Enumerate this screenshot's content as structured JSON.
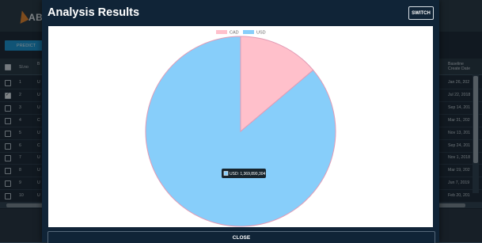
{
  "background_app": {
    "logo_text": "ABC",
    "predict_button": "PREDICT",
    "table": {
      "headers": [
        "Sl.no",
        "B",
        "Baseline\nCreate Date"
      ],
      "rows": [
        {
          "sl": "1",
          "col": "U",
          "date": "Jan 26, 202",
          "checked": false
        },
        {
          "sl": "2",
          "col": "U",
          "date": "Jul 22, 2018",
          "checked": true
        },
        {
          "sl": "3",
          "col": "U",
          "date": "Sep 14, 201",
          "checked": false
        },
        {
          "sl": "4",
          "col": "C",
          "date": "Mar 31, 202",
          "checked": false
        },
        {
          "sl": "5",
          "col": "U",
          "date": "Nov 13, 201",
          "checked": false
        },
        {
          "sl": "6",
          "col": "C",
          "date": "Sep 24, 201",
          "checked": false
        },
        {
          "sl": "7",
          "col": "U",
          "date": "Nov 1, 2018",
          "checked": false
        },
        {
          "sl": "8",
          "col": "U",
          "date": "Mar 19, 202",
          "checked": false
        },
        {
          "sl": "9",
          "col": "U",
          "date": "Jun 7, 2019",
          "checked": false
        },
        {
          "sl": "10",
          "col": "U",
          "date": "Feb 20, 201",
          "checked": false
        }
      ]
    }
  },
  "modal": {
    "title": "Analysis Results",
    "switch_label": "SWITCH",
    "close_label": "CLOSE"
  },
  "chart_data": {
    "type": "pie",
    "labels": [
      "CAD",
      "USD"
    ],
    "values": [
      220000000,
      1369890304
    ],
    "colors": [
      "#ffc0cb",
      "#87cefa"
    ],
    "legend_position": "top",
    "tooltip": {
      "label": "USD",
      "value_text": "1,369,890,304",
      "text": "USD: 1,369,890,304"
    }
  }
}
